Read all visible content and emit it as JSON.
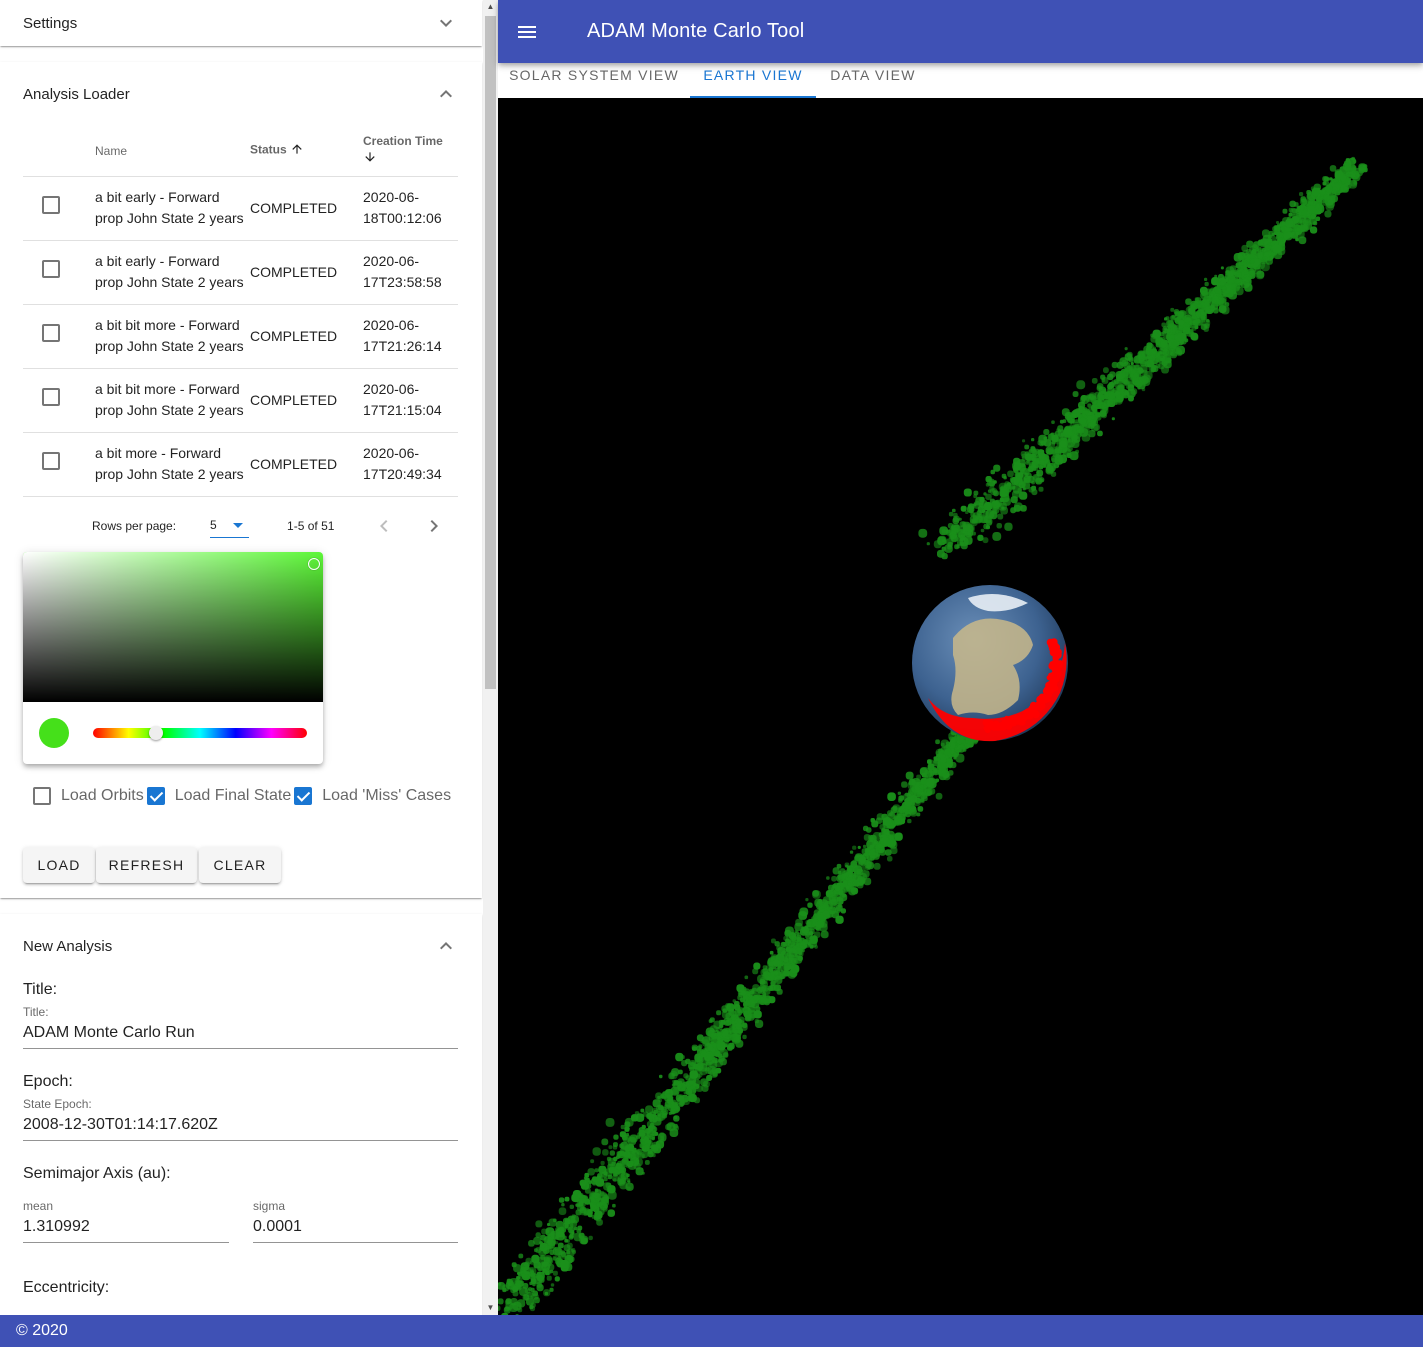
{
  "drawer": {
    "settings_panel": {
      "title": "Settings"
    },
    "loader_panel": {
      "title": "Analysis Loader",
      "table": {
        "headers": {
          "name": "Name",
          "status": "Status",
          "creation_time": "Creation Time"
        },
        "rows": [
          {
            "name": "a bit early - Forward prop John State 2 years",
            "status": "COMPLETED",
            "time": "2020-06-18T00:12:06"
          },
          {
            "name": "a bit early - Forward prop John State 2 years",
            "status": "COMPLETED",
            "time": "2020-06-17T23:58:58"
          },
          {
            "name": "a bit bit more - Forward prop John State 2 years",
            "status": "COMPLETED",
            "time": "2020-06-17T21:26:14"
          },
          {
            "name": "a bit bit more - Forward prop John State 2 years",
            "status": "COMPLETED",
            "time": "2020-06-17T21:15:04"
          },
          {
            "name": "a bit more - Forward prop John State 2 years",
            "status": "COMPLETED",
            "time": "2020-06-17T20:49:34"
          }
        ]
      },
      "pagination": {
        "rows_per_page_label": "Rows per page:",
        "rows_per_page_value": "5",
        "range": "1-5 of 51"
      },
      "color_picker": {
        "selected_color": "#45e01a",
        "hue_color": "#5cf737"
      },
      "options": {
        "load_orbits": {
          "label": "Load Orbits",
          "checked": false
        },
        "load_final_state": {
          "label": "Load Final State",
          "checked": true
        },
        "load_miss_cases": {
          "label": "Load 'Miss' Cases",
          "checked": true
        }
      },
      "buttons": {
        "load": "LOAD",
        "refresh": "REFRESH",
        "clear": "CLEAR"
      }
    },
    "new_analysis_panel": {
      "title": "New Analysis",
      "title_section": {
        "heading": "Title:",
        "label": "Title:",
        "value": "ADAM Monte Carlo Run"
      },
      "epoch_section": {
        "heading": "Epoch:",
        "label": "State Epoch:",
        "value": "2008-12-30T01:14:17.620Z"
      },
      "semimajor_section": {
        "heading": "Semimajor Axis (au):",
        "mean_label": "mean",
        "mean_value": "1.310992",
        "sigma_label": "sigma",
        "sigma_value": "0.0001"
      },
      "eccentricity_section": {
        "heading": "Eccentricity:"
      }
    }
  },
  "appbar": {
    "title": "ADAM Monte Carlo Tool"
  },
  "tabs": [
    {
      "label": "SOLAR SYSTEM VIEW",
      "active": false
    },
    {
      "label": "EARTH VIEW",
      "active": true
    },
    {
      "label": "DATA VIEW",
      "active": false
    }
  ],
  "viewport": {
    "background": "#000000",
    "point_color": "#1a8f1a",
    "miss_color": "#ff0000"
  },
  "footer": {
    "text": "© 2020"
  }
}
